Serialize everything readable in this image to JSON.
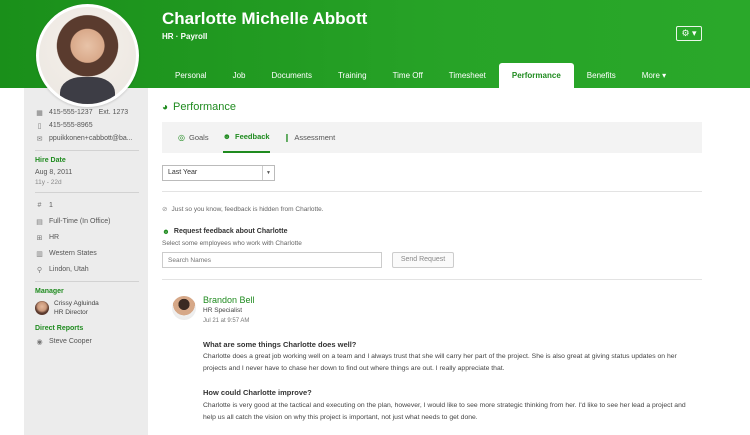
{
  "header": {
    "name": "Charlotte Michelle Abbott",
    "subtitle": "HR · Payroll",
    "gear_label": "⚙ ▾",
    "tabs": [
      {
        "label": "Personal"
      },
      {
        "label": "Job"
      },
      {
        "label": "Documents"
      },
      {
        "label": "Training"
      },
      {
        "label": "Time Off"
      },
      {
        "label": "Timesheet"
      },
      {
        "label": "Performance"
      },
      {
        "label": "Benefits"
      },
      {
        "label": "More ▾"
      }
    ]
  },
  "sidebar": {
    "work_phone": "415-555-1237",
    "work_ext": "Ext. 1273",
    "mobile_phone": "415-555-8965",
    "email": "ppuikkonen+cabbott@ba...",
    "hire_date_label": "Hire Date",
    "hire_date": "Aug 8, 2011",
    "tenure": "11y - 22d",
    "employee_number": "1",
    "employment_status": "Full-Time (In Office)",
    "department": "HR",
    "division": "Western States",
    "location": "Lindon, Utah",
    "manager_label": "Manager",
    "manager_name": "Crissy Agluinda",
    "manager_title": "HR Director",
    "direct_reports_label": "Direct Reports",
    "direct_report_name": "Steve Cooper"
  },
  "main": {
    "section_title": "Performance",
    "subtabs": [
      {
        "label": "Goals"
      },
      {
        "label": "Feedback"
      },
      {
        "label": "Assessment"
      }
    ],
    "period_select": "Last Year",
    "hidden_note": "Just so you know, feedback is hidden from Charlotte.",
    "request_title": "Request feedback about Charlotte",
    "request_sub": "Select some employees who work with Charlotte",
    "search_placeholder": "Search Names",
    "send_button": "Send Request",
    "feedback": {
      "author": "Brandon Bell",
      "role": "HR Specialist",
      "date": "Jul 21 at 9:57 AM",
      "q1": "What are some things Charlotte does well?",
      "a1": "Charlotte does a great job working well on a team and I always trust that she will carry her part of the project. She is also great at giving status updates on her projects and I never have to chase her down to find out where things are out. I really appreciate that.",
      "q2": "How could Charlotte improve?",
      "a2": "Charlotte is very good at the tactical and executing on the plan, however, I would like to see more strategic thinking from her. I'd like to see her lead a project and help us all catch the vision on why this project is important, not just what needs to get done."
    }
  }
}
